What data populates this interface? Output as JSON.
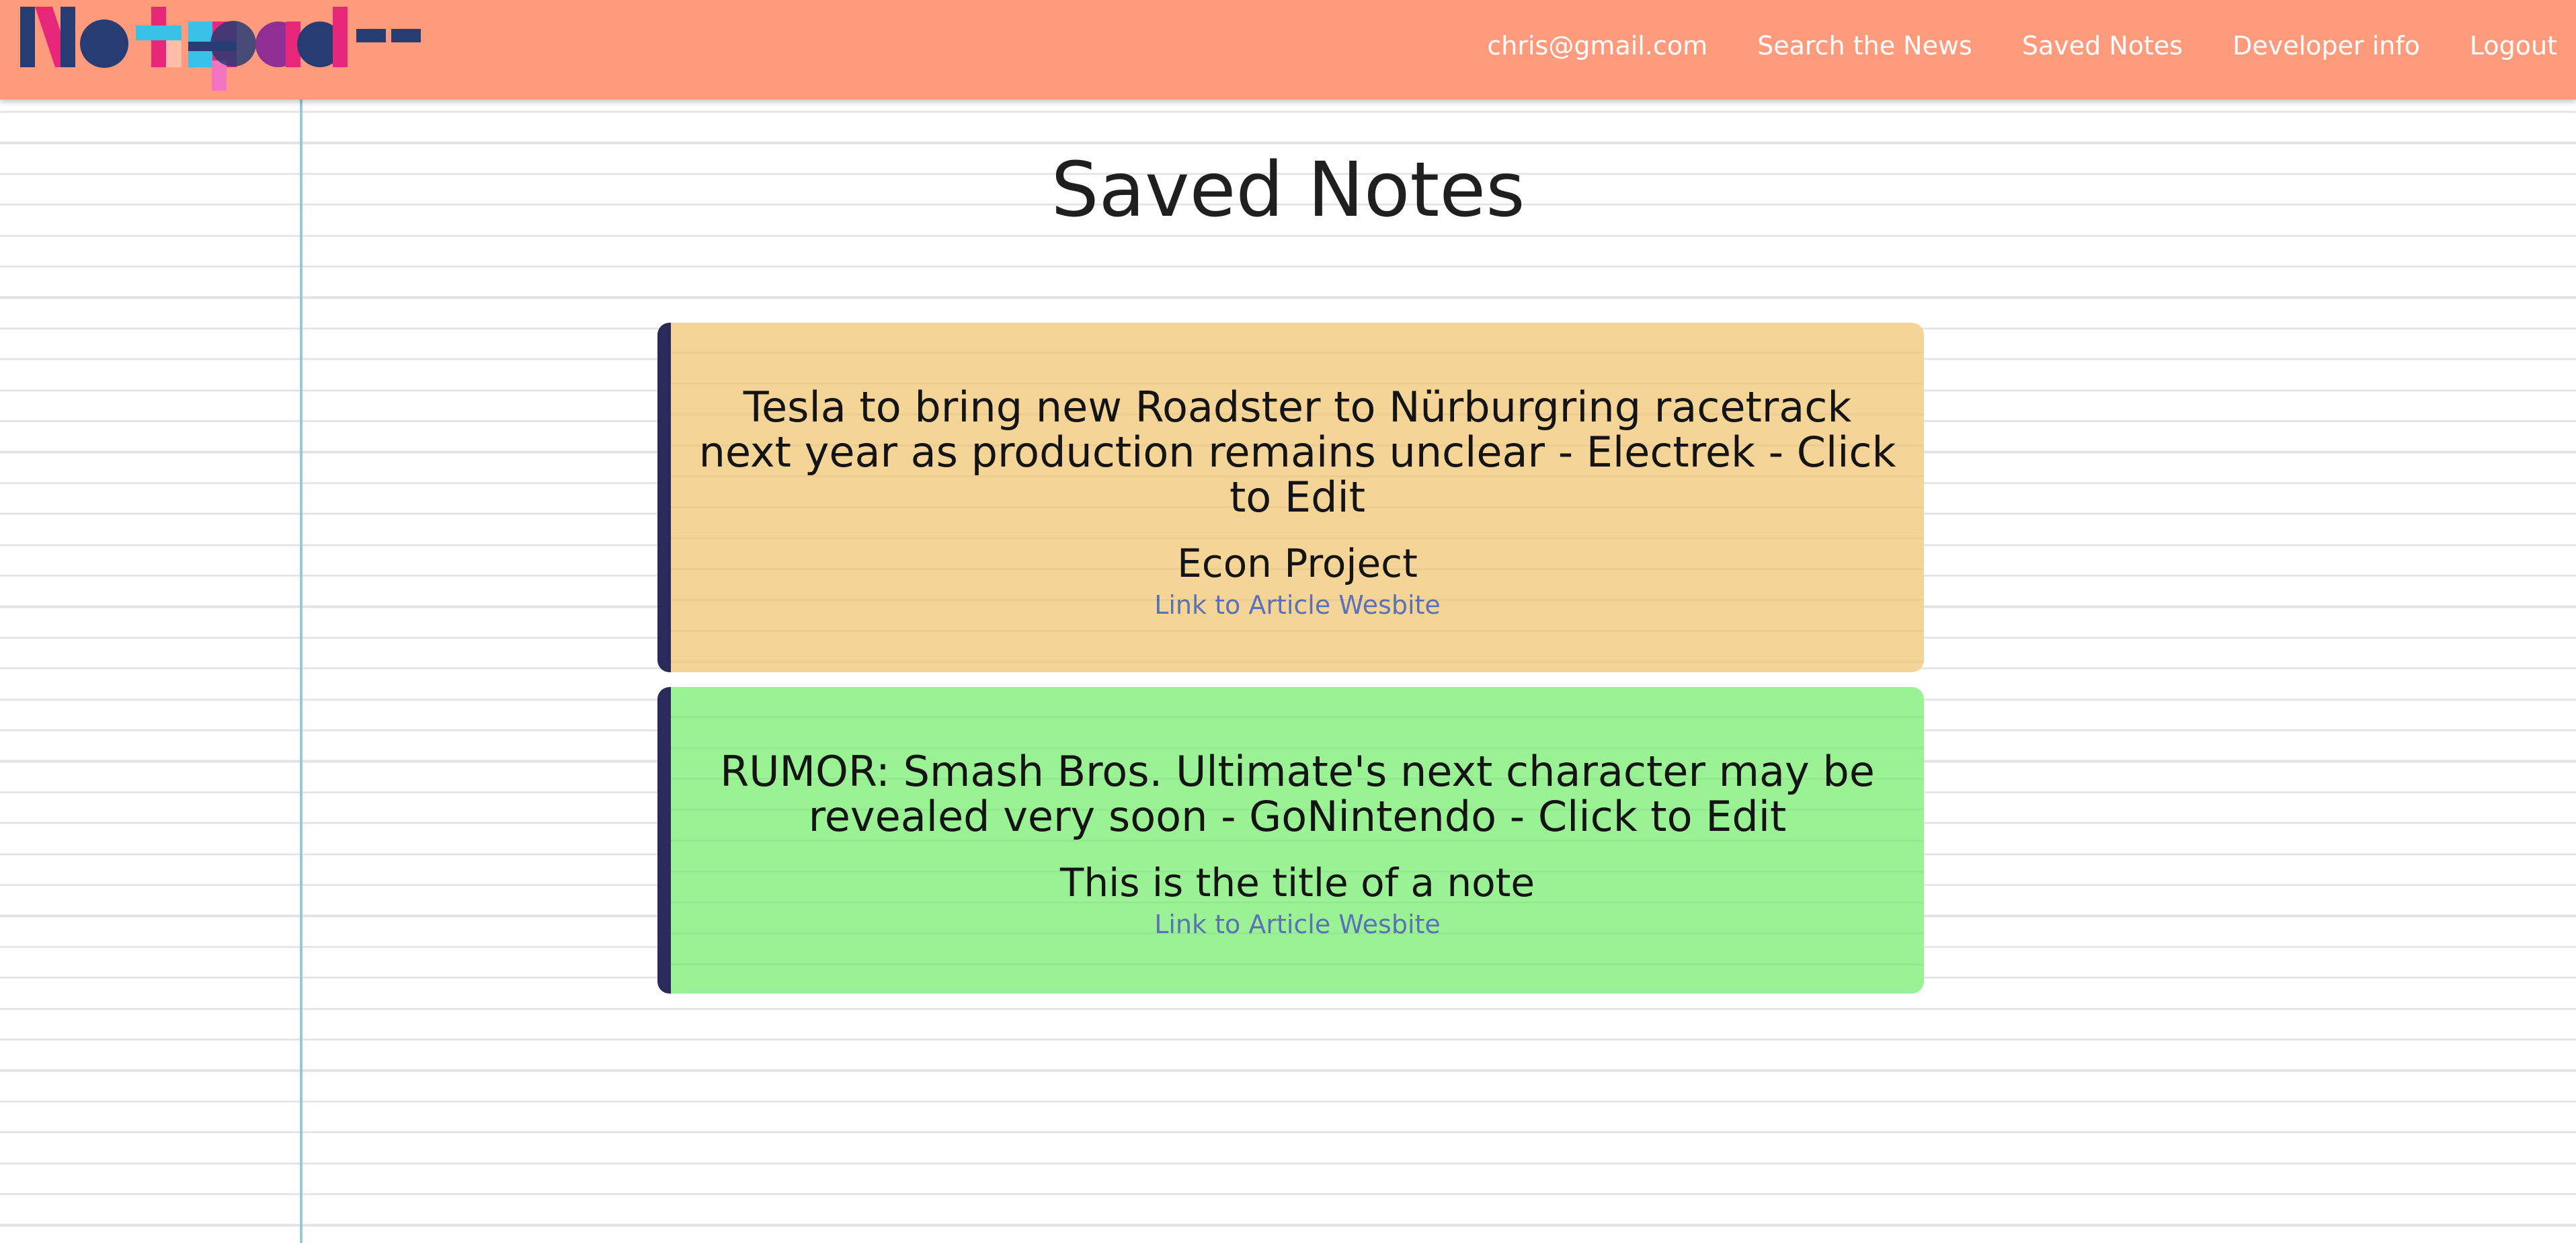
{
  "brand": {
    "name": "Notepad--",
    "colors": {
      "header": "#ff9b7d",
      "note_yellow": "#f5d597",
      "note_green": "#9af295",
      "note_border": "#2b2b5b",
      "link": "#5a72b6",
      "margin_line": "#9cc6dc"
    }
  },
  "nav": {
    "items": [
      {
        "label": "chris@gmail.com"
      },
      {
        "label": "Search the News"
      },
      {
        "label": "Saved Notes"
      },
      {
        "label": "Developer info"
      },
      {
        "label": "Logout"
      }
    ]
  },
  "main": {
    "title": "Saved Notes",
    "notes": [
      {
        "headline": "Tesla to bring new Roadster to Nürburgring racetrack next year as production remains unclear - Electrek - Click to Edit",
        "title": "Econ Project",
        "link_label": "Link to Article Wesbite",
        "color": "#f5d597"
      },
      {
        "headline": "RUMOR: Smash Bros. Ultimate's next character may be revealed very soon - GoNintendo - Click to Edit",
        "title": "This is the title of a note",
        "link_label": "Link to Article Wesbite",
        "color": "#9af295"
      }
    ]
  }
}
